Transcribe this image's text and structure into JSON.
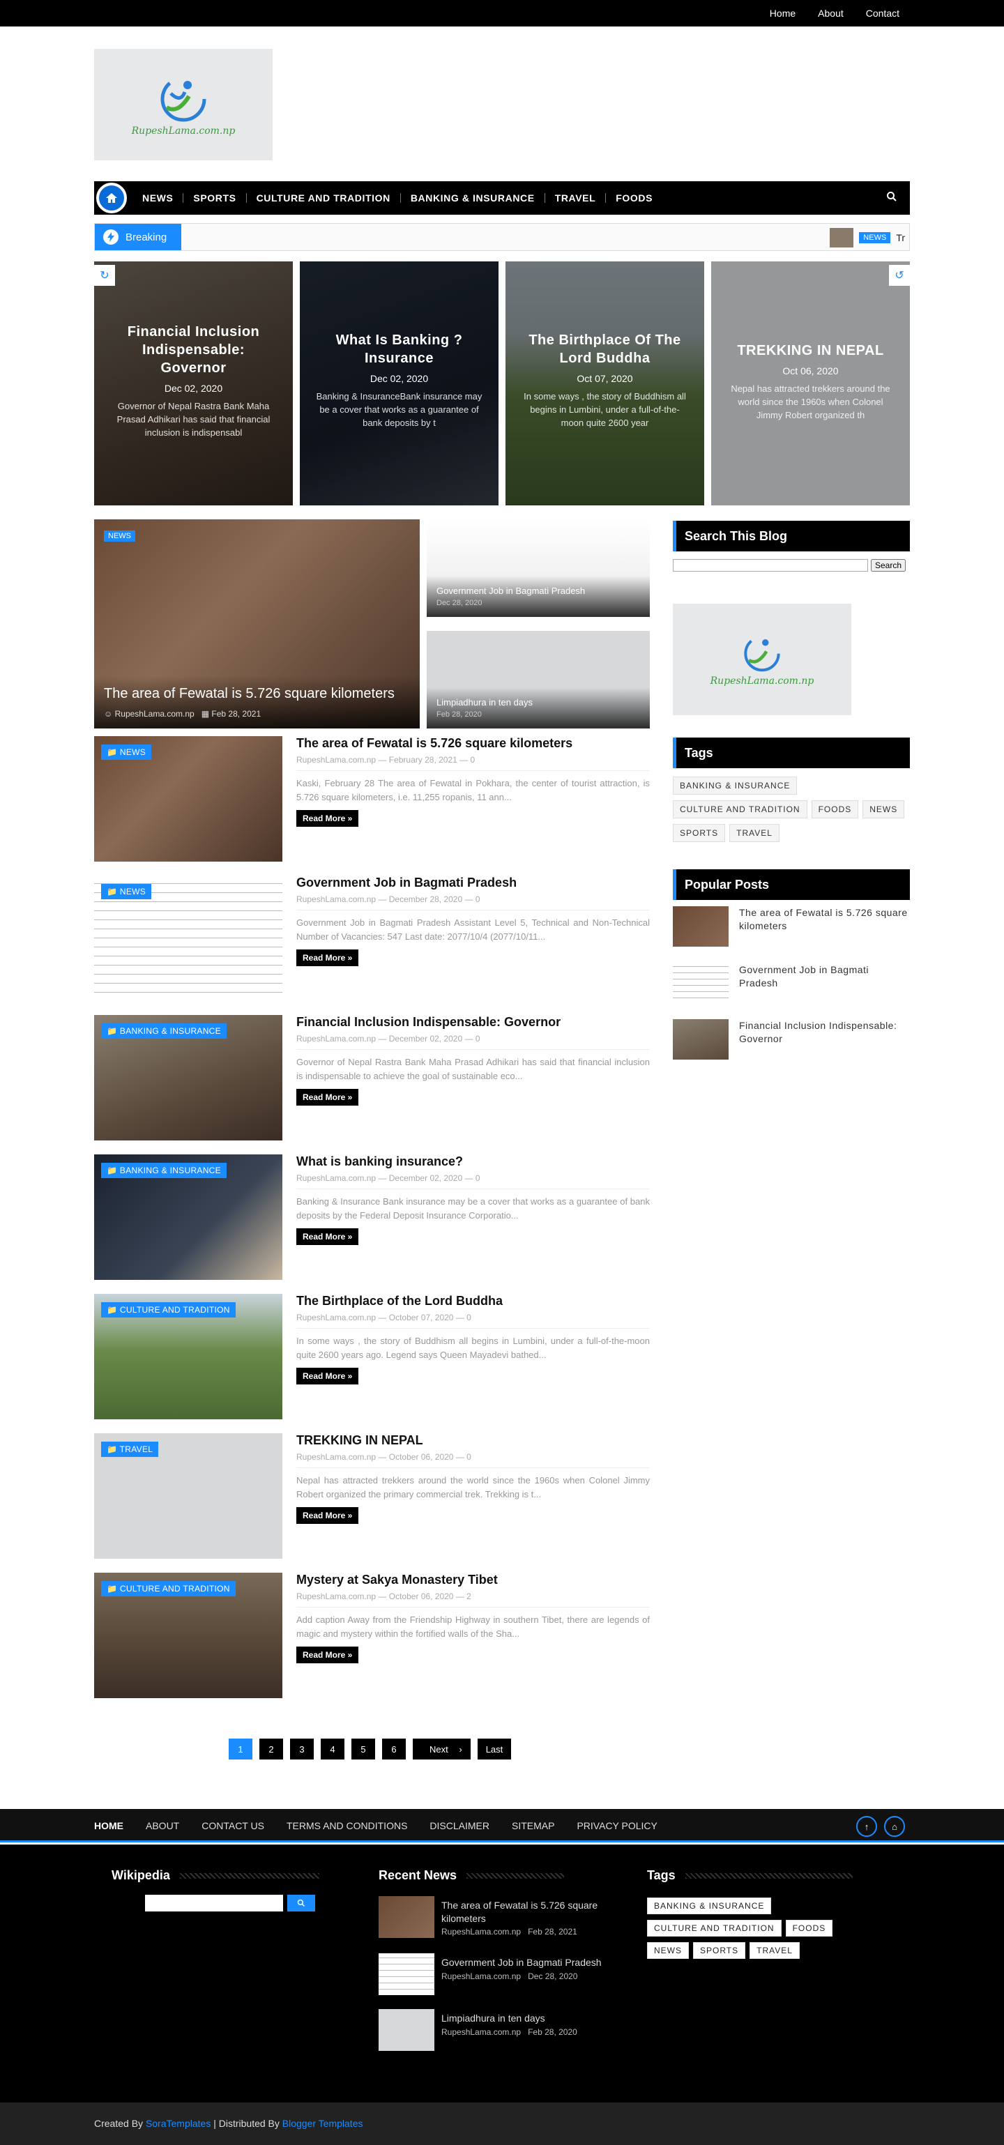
{
  "topbar": {
    "links": [
      "Home",
      "About",
      "Contact"
    ]
  },
  "logo": {
    "text": "RupeshLama.com.np"
  },
  "nav": {
    "items": [
      "NEWS",
      "SPORTS",
      "CULTURE AND TRADITION",
      "BANKING & INSURANCE",
      "TRAVEL",
      "FOODS"
    ]
  },
  "breaking": {
    "label": "Breaking",
    "badge": "NEWS",
    "snippet": "Tr"
  },
  "slider": [
    {
      "title": "Financial Inclusion Indispensable: Governor",
      "date": "Dec 02, 2020",
      "excerpt": "Governor of Nepal Rastra Bank Maha Prasad Adhikari has said that financial inclusion is indispensabl"
    },
    {
      "title": "What Is Banking ?Insurance",
      "date": "Dec 02, 2020",
      "excerpt": "Banking & InsuranceBank insurance may be a cover that works as a guarantee of bank deposits by t"
    },
    {
      "title": "The Birthplace Of The Lord Buddha",
      "date": "Oct 07, 2020",
      "excerpt": "In some ways , the story of Buddhism all begins in Lumbini, under a full-of-the-moon quite 2600 year"
    },
    {
      "title": "TREKKING IN NEPAL",
      "date": "Oct 06, 2020",
      "excerpt": "Nepal has attracted trekkers around the world since the 1960s when Colonel Jimmy Robert organized th"
    }
  ],
  "featured": {
    "big": {
      "badge": "NEWS",
      "title": "The area of Fewatal is 5.726 square kilometers",
      "author": "RupeshLama.com.np",
      "date": "Feb 28, 2021"
    },
    "small": [
      {
        "title": "Government Job in Bagmati Pradesh",
        "date": "Dec 28, 2020"
      },
      {
        "title": "Limpiadhura in ten days",
        "date": "Feb 28, 2020"
      }
    ]
  },
  "posts": [
    {
      "cat": "NEWS",
      "title": "The area of Fewatal is 5.726 square kilometers",
      "author": "RupeshLama.com.np",
      "date": "February 28, 2021",
      "comments": "0",
      "excerpt": "Kaski, February 28 The area of Fewatal in Pokhara, the center of tourist attraction, is 5.726 square kilometers, i.e. 11,255 ropanis, 11 ann..."
    },
    {
      "cat": "NEWS",
      "title": "Government Job in Bagmati Pradesh",
      "author": "RupeshLama.com.np",
      "date": "December 28, 2020",
      "comments": "0",
      "excerpt": "Government Job in Bagmati Pradesh Assistant Level 5, Technical and Non-Technical Number of Vacancies: 547 Last date: 2077/10/4 (2077/10/11..."
    },
    {
      "cat": "BANKING & INSURANCE",
      "title": "Financial Inclusion Indispensable: Governor",
      "author": "RupeshLama.com.np",
      "date": "December 02, 2020",
      "comments": "0",
      "excerpt": "Governor of Nepal Rastra Bank Maha Prasad Adhikari has said that financial inclusion is indispensable to achieve the goal of sustainable eco..."
    },
    {
      "cat": "BANKING & INSURANCE",
      "title": "What is banking insurance?",
      "author": "RupeshLama.com.np",
      "date": "December 02, 2020",
      "comments": "0",
      "excerpt": "Banking & Insurance Bank insurance may be a cover that works as a guarantee of bank deposits by the Federal Deposit Insurance Corporatio..."
    },
    {
      "cat": "CULTURE AND TRADITION",
      "title": "The Birthplace of the Lord Buddha",
      "author": "RupeshLama.com.np",
      "date": "October 07, 2020",
      "comments": "0",
      "excerpt": "In some ways , the story of Buddhism all begins in Lumbini, under a full-of-the-moon quite 2600 years ago. Legend says Queen Mayadevi bathed..."
    },
    {
      "cat": "TRAVEL",
      "title": "TREKKING IN NEPAL",
      "author": "RupeshLama.com.np",
      "date": "October 06, 2020",
      "comments": "0",
      "excerpt": "Nepal has attracted trekkers around the world since the 1960s when Colonel Jimmy Robert organized the primary commercial trek. Trekking is t..."
    },
    {
      "cat": "CULTURE AND TRADITION",
      "title": "Mystery at Sakya Monastery Tibet",
      "author": "RupeshLama.com.np",
      "date": "October 06, 2020",
      "comments": "2",
      "excerpt": "Add caption Away from the Friendship Highway in southern Tibet, there are legends of magic and mystery within the fortified walls of the Sha..."
    }
  ],
  "read_more": "Read More »",
  "sidebar": {
    "search_title": "Search This Blog",
    "search_button": "Search",
    "tags_title": "Tags",
    "tags": [
      "BANKING & INSURANCE",
      "CULTURE AND TRADITION",
      "FOODS",
      "NEWS",
      "SPORTS",
      "TRAVEL"
    ],
    "popular_title": "Popular Posts",
    "popular": [
      "The area of Fewatal is 5.726 square kilometers",
      "Government Job in Bagmati Pradesh",
      "Financial Inclusion Indispensable: Governor"
    ]
  },
  "pager": {
    "pages": [
      "1",
      "2",
      "3",
      "4",
      "5",
      "6"
    ],
    "next": "Next",
    "last": "Last"
  },
  "footer_nav": [
    "HOME",
    "ABOUT",
    "CONTACT US",
    "TERMS AND CONDITIONS",
    "DISCLAIMER",
    "SITEMAP",
    "PRIVACY POLICY"
  ],
  "footer": {
    "wiki_title": "Wikipedia",
    "recent_title": "Recent News",
    "recent": [
      {
        "title": "The area of Fewatal is 5.726 square kilometers",
        "author": "RupeshLama.com.np",
        "date": "Feb 28, 2021"
      },
      {
        "title": "Government Job in Bagmati Pradesh",
        "author": "RupeshLama.com.np",
        "date": "Dec 28, 2020"
      },
      {
        "title": "Limpiadhura in ten days",
        "author": "RupeshLama.com.np",
        "date": "Feb 28, 2020"
      }
    ],
    "tags_title": "Tags",
    "tags": [
      "BANKING & INSURANCE",
      "CULTURE AND TRADITION",
      "FOODS",
      "NEWS",
      "SPORTS",
      "TRAVEL"
    ]
  },
  "credit": {
    "created": "Created By",
    "sora": "SoraTemplates",
    "sep": "| Distributed By",
    "blogger": "Blogger Templates"
  },
  "colors": {
    "accent": "#1a8cff",
    "dark": "#000000"
  }
}
